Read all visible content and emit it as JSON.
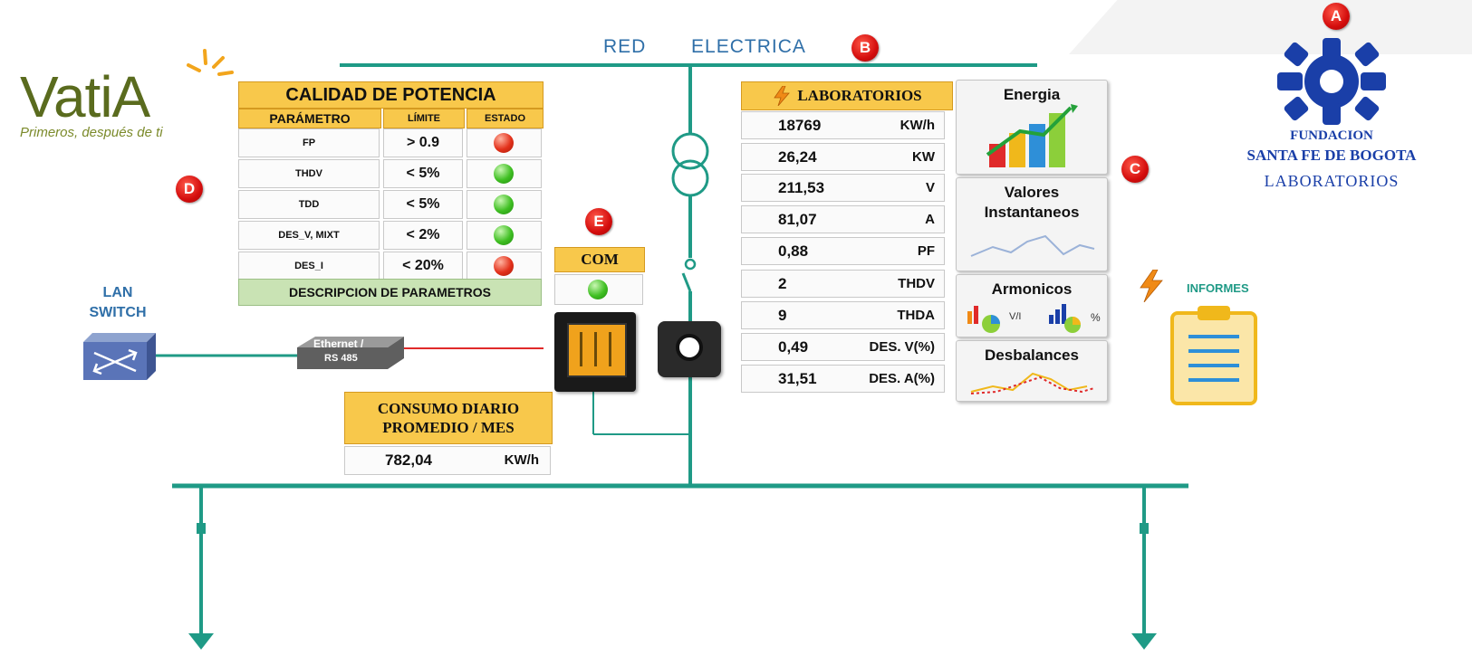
{
  "network": {
    "title_red": "RED",
    "title_electrica": "ELECTRICA"
  },
  "markers": {
    "a": "A",
    "b": "B",
    "c": "C",
    "d": "D",
    "e": "E"
  },
  "vatia": {
    "logo_text": "VatiA",
    "tagline": "Primeros, después de ti"
  },
  "fundacion": {
    "line1": "FUNDACION",
    "line2": "SANTA FE DE BOGOTA",
    "line3": "LABORATORIOS"
  },
  "calidad": {
    "title": "CALIDAD DE POTENCIA",
    "headers": [
      "PARÁMETRO",
      "LÍMITE",
      "ESTADO"
    ],
    "rows": [
      {
        "param": "FP",
        "limit": "> 0.9",
        "status": "red"
      },
      {
        "param": "THDV",
        "limit": "< 5%",
        "status": "green"
      },
      {
        "param": "TDD",
        "limit": "< 5%",
        "status": "green"
      },
      {
        "param": "DES_V, MIXT",
        "limit": "< 2%",
        "status": "green"
      },
      {
        "param": "DES_I",
        "limit": "< 20%",
        "status": "red"
      }
    ],
    "footer": "DESCRIPCION DE PARAMETROS"
  },
  "com": {
    "label": "COM",
    "status": "green"
  },
  "lan": {
    "line1": "LAN",
    "line2": "SWITCH"
  },
  "converter": {
    "line1": "Ethernet /",
    "line2": "RS 485"
  },
  "consumo": {
    "line1": "CONSUMO DIARIO",
    "line2": "PROMEDIO / MES",
    "value": "782,04",
    "unit": "KW/h"
  },
  "laboratorios": {
    "title": "LABORATORIOS",
    "rows": [
      {
        "value": "18769",
        "unit": "KW/h"
      },
      {
        "value": "26,24",
        "unit": "KW"
      },
      {
        "value": "211,53",
        "unit": "V"
      },
      {
        "value": "81,07",
        "unit": "A"
      },
      {
        "value": "0,88",
        "unit": "PF"
      },
      {
        "value": "2",
        "unit": "THDV"
      },
      {
        "value": "9",
        "unit": "THDA"
      },
      {
        "value": "0,49",
        "unit": "DES. V(%)"
      },
      {
        "value": "31,51",
        "unit": "DES. A(%)"
      }
    ]
  },
  "buttons": {
    "energia": "Energia",
    "valores_1": "Valores",
    "valores_2": "Instantaneos",
    "armonicos": "Armonicos",
    "armonicos_v": "V/I",
    "armonicos_pct": "%",
    "desbalances": "Desbalances"
  },
  "informes": {
    "label": "INFORMES"
  },
  "colors": {
    "bus": "#1f9a86",
    "accent_yellow": "#f8c84b",
    "blue": "#2460a8",
    "red_led": "#e3311b",
    "green_led": "#3fbf22"
  },
  "icons": [
    "bolt-icon",
    "bar-chart-icon",
    "line-chart-icon",
    "clipboard-icon",
    "network-switch-icon",
    "transformer-icon",
    "switch-icon",
    "meter-icon",
    "current-transformer-icon",
    "arrow-down-icon"
  ]
}
